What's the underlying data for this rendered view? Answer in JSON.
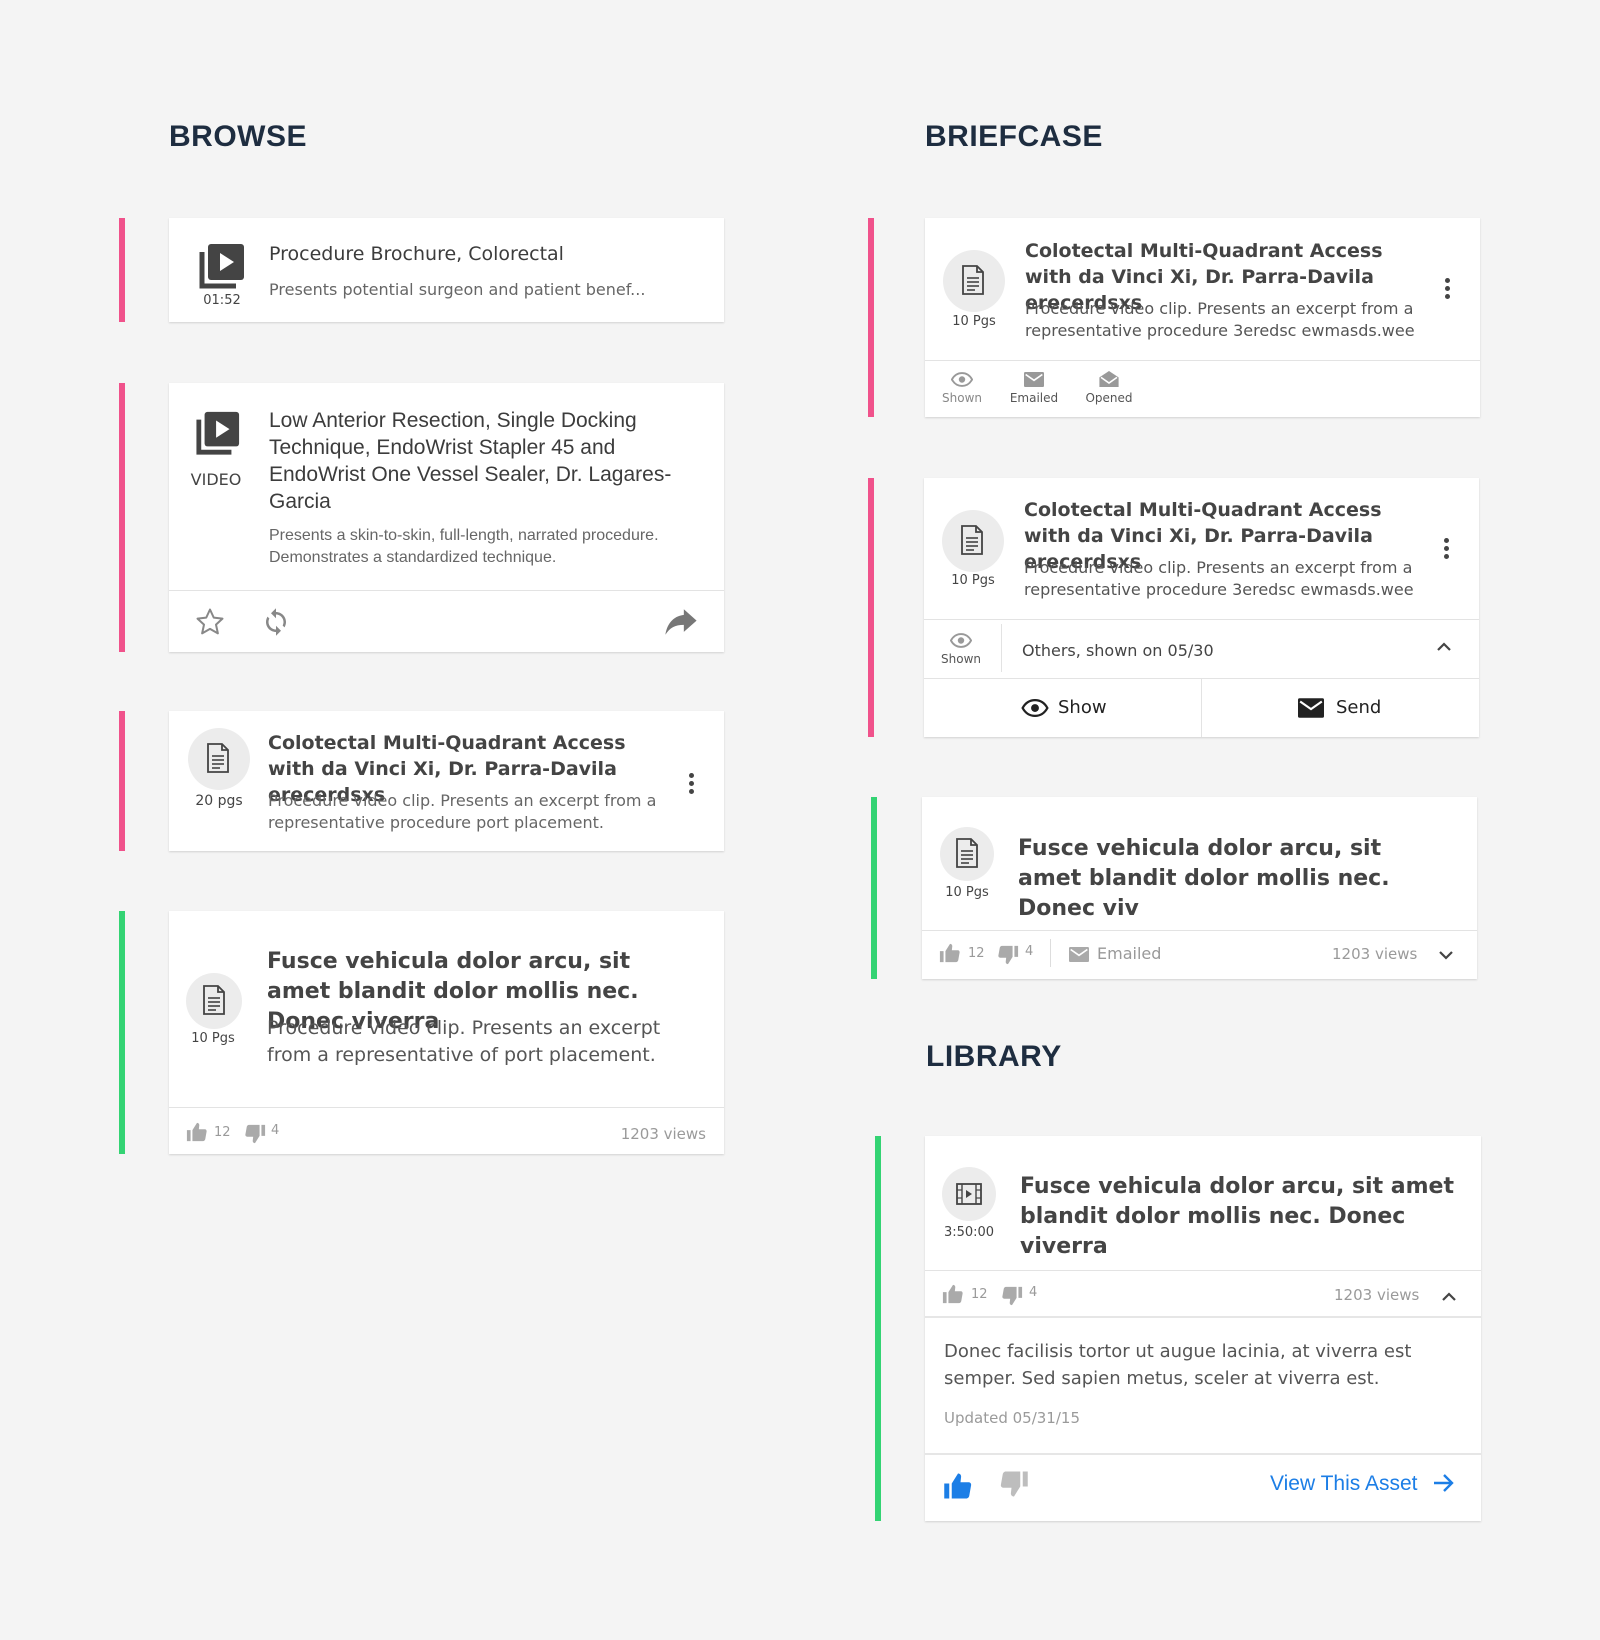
{
  "sections": {
    "browse": "BROWSE",
    "briefcase": "BRIEFCASE",
    "library": "LIBRARY"
  },
  "colors": {
    "pink": "#f0528b",
    "green": "#33d373",
    "link": "#1c7ee6"
  },
  "browse": {
    "card1": {
      "title": "Procedure Brochure, Colorectal",
      "desc": "Presents potential surgeon and patient benef...",
      "duration": "01:52",
      "icon": "video-play-icon"
    },
    "card2": {
      "title": "Low Anterior Resection, Single Docking Technique, EndoWrist Stapler 45 and EndoWrist One Vessel Sealer, Dr. Lagares-Garcia",
      "desc": "Presents a skin-to-skin, full-length, narrated procedure. Demonstrates a standardized technique.",
      "type_label": "VIDEO",
      "icon": "video-play-icon"
    },
    "card3": {
      "title": "Colotectal Multi-Quadrant Access with da Vinci Xi, Dr. Parra-Davila erecerdsxs",
      "desc": "Procedure video clip. Presents an excerpt from a representative procedure port placement.",
      "pages": "20 pgs"
    },
    "card4": {
      "title": "Fusce vehicula dolor arcu, sit amet blandit dolor mollis nec. Donec viverra",
      "desc": "Procedure video clip. Presents an excerpt from a representative of port placement.",
      "pages": "10 Pgs",
      "likes": "12",
      "dislikes": "4",
      "views": "1203 views"
    }
  },
  "briefcase": {
    "card1": {
      "title": "Colotectal Multi-Quadrant Access with da Vinci Xi, Dr. Parra-Davila erecerdsxs",
      "desc": "Procedure video clip. Presents an excerpt from a representative procedure 3eredsc ewmasds.wee",
      "pages": "10 Pgs",
      "shown": "Shown",
      "emailed": "Emailed",
      "opened": "Opened"
    },
    "card2": {
      "title": "Colotectal Multi-Quadrant Access with da Vinci Xi, Dr. Parra-Davila erecerdsxs",
      "desc": "Procedure video clip. Presents an excerpt from a representative procedure 3eredsc ewmasds.wee",
      "pages": "10 Pgs",
      "shown": "Shown",
      "shown_info": "Others, shown on 05/30",
      "show_btn": "Show",
      "send_btn": "Send"
    },
    "card3": {
      "title": "Fusce vehicula dolor arcu, sit amet blandit dolor mollis nec. Donec viv",
      "pages": "10 Pgs",
      "likes": "12",
      "dislikes": "4",
      "emailed": "Emailed",
      "views": "1203 views"
    }
  },
  "library": {
    "card1": {
      "title": "Fusce vehicula dolor arcu, sit amet blandit dolor mollis nec. Donec viverra",
      "duration": "3:50:00",
      "likes": "12",
      "dislikes": "4",
      "views": "1203 views",
      "desc": "Donec facilisis tortor ut augue lacinia, at viverra est semper. Sed sapien metus, sceler at viverra est.",
      "updated": "Updated 05/31/15",
      "view_asset": "View This Asset"
    }
  }
}
